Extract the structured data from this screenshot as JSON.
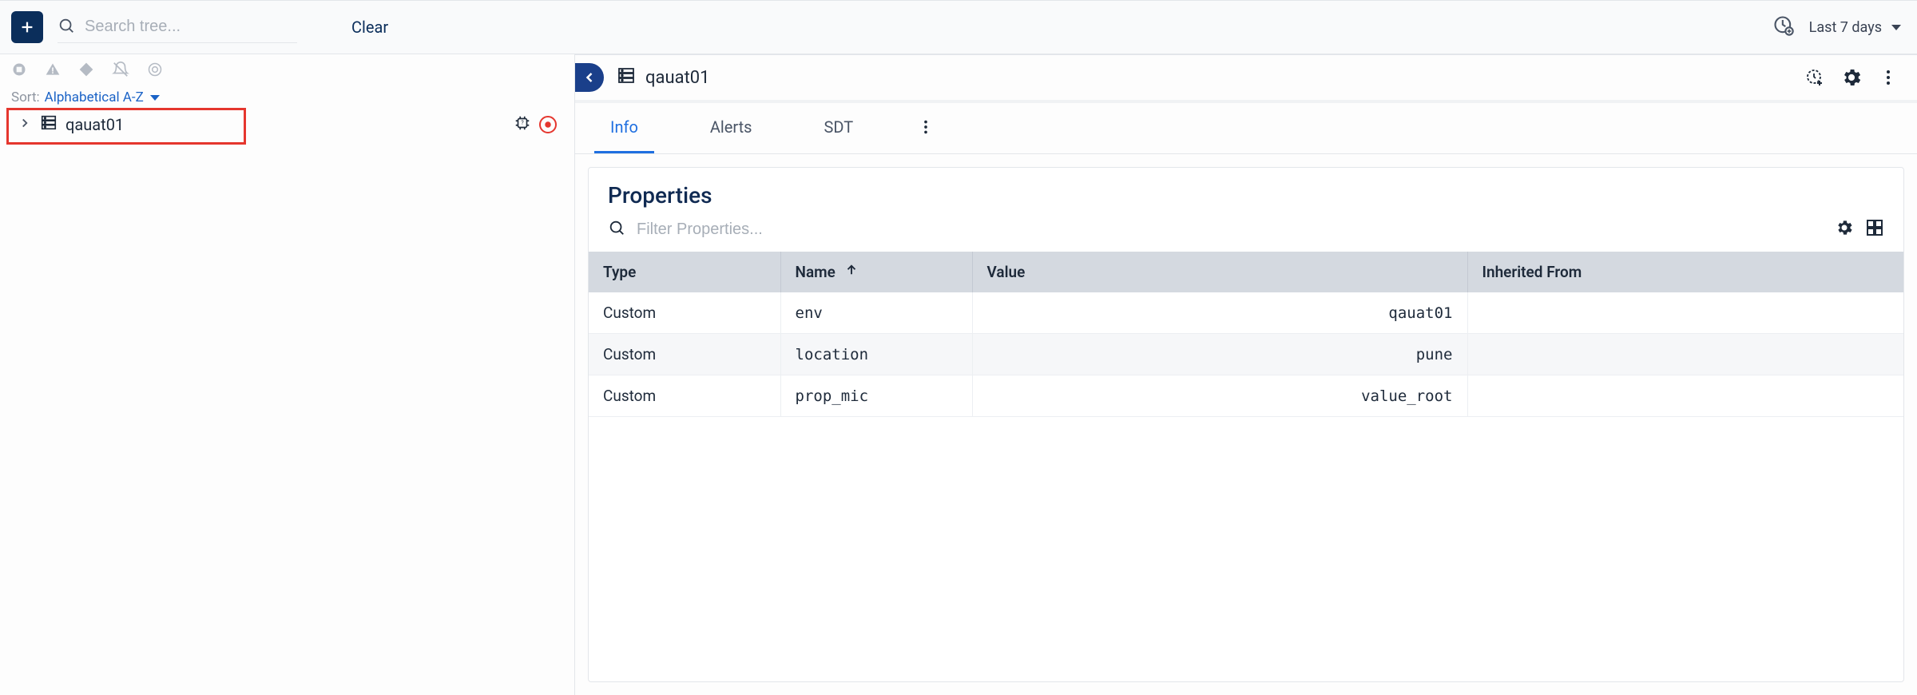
{
  "topbar": {
    "search_placeholder": "Search tree...",
    "clear_label": "Clear",
    "time_range_label": "Last 7 days"
  },
  "sidebar": {
    "sort_label": "Sort:",
    "sort_value": "Alphabetical A-Z",
    "tree_items": [
      {
        "label": "qauat01"
      }
    ]
  },
  "detail": {
    "title": "qauat01",
    "tabs": [
      {
        "label": "Info",
        "active": true
      },
      {
        "label": "Alerts",
        "active": false
      },
      {
        "label": "SDT",
        "active": false
      }
    ],
    "properties": {
      "panel_title": "Properties",
      "filter_placeholder": "Filter Properties...",
      "columns": {
        "type": "Type",
        "name": "Name",
        "value": "Value",
        "inherited": "Inherited From"
      },
      "sort_column": "name",
      "sort_dir": "asc",
      "rows": [
        {
          "type": "Custom",
          "name": "env",
          "value": "qauat01",
          "inherited": ""
        },
        {
          "type": "Custom",
          "name": "location",
          "value": "pune",
          "inherited": ""
        },
        {
          "type": "Custom",
          "name": "prop_mic",
          "value": "value_root",
          "inherited": ""
        }
      ]
    }
  }
}
